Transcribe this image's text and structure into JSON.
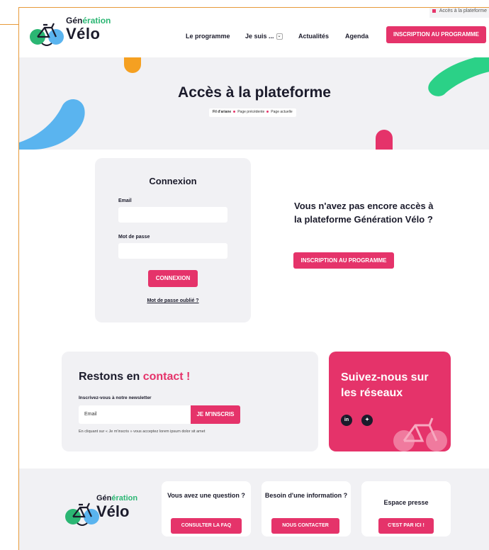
{
  "brand": {
    "line1_a": "Gén",
    "line1_b": "ération",
    "line2": "Vélo",
    "pink": "#e5336a",
    "green": "#2bb673",
    "blue": "#5ab4ef",
    "orange": "#f5a021"
  },
  "top_link": "Accès à la plateforme",
  "nav": {
    "items": [
      "Le programme",
      "Je suis ...",
      "Actualités",
      "Agenda"
    ],
    "cta": "INSCRIPTION AU PROGRAMME"
  },
  "hero": {
    "title": "Accès à la plateforme",
    "crumbs": [
      "Fil d'ariane",
      "Page précédente",
      "Page actuelle"
    ]
  },
  "login": {
    "title": "Connexion",
    "email_label": "Email",
    "password_label": "Mot de passe",
    "submit": "CONNEXION",
    "forgot": "Mot de passe oublié ?"
  },
  "promo": {
    "text": "Vous n'avez pas encore accès à la plateforme Génération Vélo ?",
    "button": "INSCRIPTION AU PROGRAMME"
  },
  "contact": {
    "title_a": "Restons en ",
    "title_b": "contact !",
    "label": "Inscrivez-vous à notre newsletter",
    "placeholder": "Email",
    "button": "JE M'INSCRIS",
    "note": "En cliquant sur « Je m'inscris » vous acceptez lorem ipsum dolor sit amet"
  },
  "social": {
    "title": "Suivez-nous sur les réseaux",
    "icons": [
      "linkedin-icon",
      "twitter-icon"
    ],
    "linkedin_glyph": "in",
    "twitter_glyph": "✦"
  },
  "footer": {
    "cards": [
      {
        "title": "Vous avez une question ?",
        "button": "CONSULTER LA FAQ"
      },
      {
        "title": "Besoin d'une information ?",
        "button": "NOUS CONTACTER"
      },
      {
        "title": "Espace presse",
        "button": "C'EST PAR ICI !"
      }
    ]
  }
}
